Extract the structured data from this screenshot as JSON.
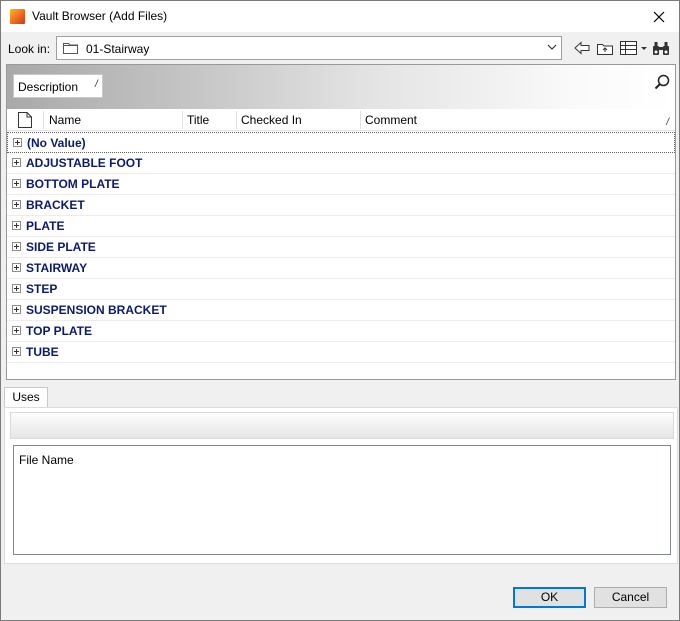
{
  "window": {
    "title": "Vault Browser (Add Files)"
  },
  "lookin": {
    "label": "Look in:",
    "value": "01-Stairway"
  },
  "group": {
    "chip_label": "Description",
    "sort_mark": "/"
  },
  "columns": {
    "name": "Name",
    "title": "Title",
    "checked_in": "Checked In",
    "comment": "Comment",
    "comment_sort_mark": "/"
  },
  "rows": [
    {
      "label": "(No Value)",
      "selected": true
    },
    {
      "label": "ADJUSTABLE FOOT"
    },
    {
      "label": "BOTTOM PLATE"
    },
    {
      "label": "BRACKET"
    },
    {
      "label": "PLATE"
    },
    {
      "label": "SIDE PLATE"
    },
    {
      "label": "STAIRWAY"
    },
    {
      "label": "STEP"
    },
    {
      "label": "SUSPENSION BRACKET"
    },
    {
      "label": "TOP PLATE"
    },
    {
      "label": "TUBE"
    }
  ],
  "tabs": [
    {
      "label": "Uses",
      "active": true
    }
  ],
  "uses": {
    "column_file_name": "File Name"
  },
  "buttons": {
    "ok": "OK",
    "cancel": "Cancel"
  },
  "icons": {
    "app": "vault-app-icon",
    "close": "close-icon",
    "folder": "folder-icon",
    "dropdown": "chevron-down-icon",
    "back": "back-arrow-icon",
    "up": "up-folder-icon",
    "views": "views-menu-icon",
    "find": "binoculars-icon",
    "search": "search-icon",
    "document": "document-icon",
    "expand": "plus-box-icon"
  },
  "colors": {
    "row_text": "#0b1a6e",
    "default_button_border": "#0078d7"
  }
}
